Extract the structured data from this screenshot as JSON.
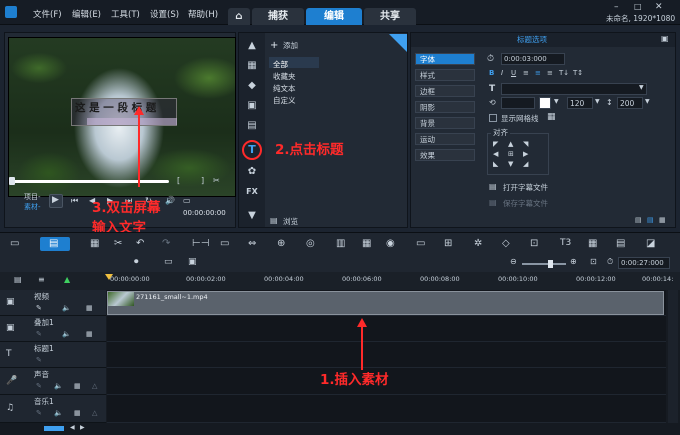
{
  "menubar": {
    "items": [
      "文件(F)",
      "编辑(E)",
      "工具(T)",
      "设置(S)",
      "帮助(H)"
    ],
    "home_icon": "home-icon",
    "tabs": [
      {
        "label": "捕获",
        "active": false
      },
      {
        "label": "编辑",
        "active": true
      },
      {
        "label": "共享",
        "active": false
      }
    ],
    "project_info": "未命名, 1920*1080"
  },
  "preview": {
    "title_text": "这 是 一 段 标 题",
    "mode_labels": [
      "项目-",
      "素材-"
    ],
    "timecode": "00:00:00:00"
  },
  "library": {
    "add_label": "添加",
    "items": [
      "全部",
      "收藏夹",
      "纯文本",
      "自定义"
    ],
    "browse_label": "浏览"
  },
  "options": {
    "title": "标题选项",
    "tabs": [
      "字体",
      "样式",
      "边框",
      "阴影",
      "背景",
      "运动",
      "效果"
    ],
    "active_tab": 0,
    "duration": "0:00:03:000",
    "font_size": "120",
    "line_spacing": "200",
    "show_grid_label": "显示网格线",
    "align_label": "对齐",
    "open_subtitle_label": "打开字幕文件",
    "save_subtitle_label": "保存字幕文件"
  },
  "toolbar": {
    "timecode": "0:00:27:000"
  },
  "ruler": {
    "ticks": [
      "00:00:00:00",
      "00:00:02:00",
      "00:00:04:00",
      "00:00:06:00",
      "00:00:08:00",
      "00:00:10:00",
      "00:00:12:00",
      "00:00:14:"
    ]
  },
  "tracks": [
    {
      "label": "视频",
      "lane_height": 26
    },
    {
      "label": "叠加1",
      "lane_height": 26
    },
    {
      "label": "标题1",
      "lane_height": 26
    },
    {
      "label": "声音",
      "lane_height": 27
    },
    {
      "label": "音乐1",
      "lane_height": 28
    }
  ],
  "clip": {
    "name": "271161_small~1.mp4"
  },
  "annotations": {
    "step1": "1.插入素材",
    "step2": "2.点击标题",
    "step3_line1": "3.双击屏幕",
    "step3_line2": "输入文字",
    "color": "#ff2a2a"
  }
}
